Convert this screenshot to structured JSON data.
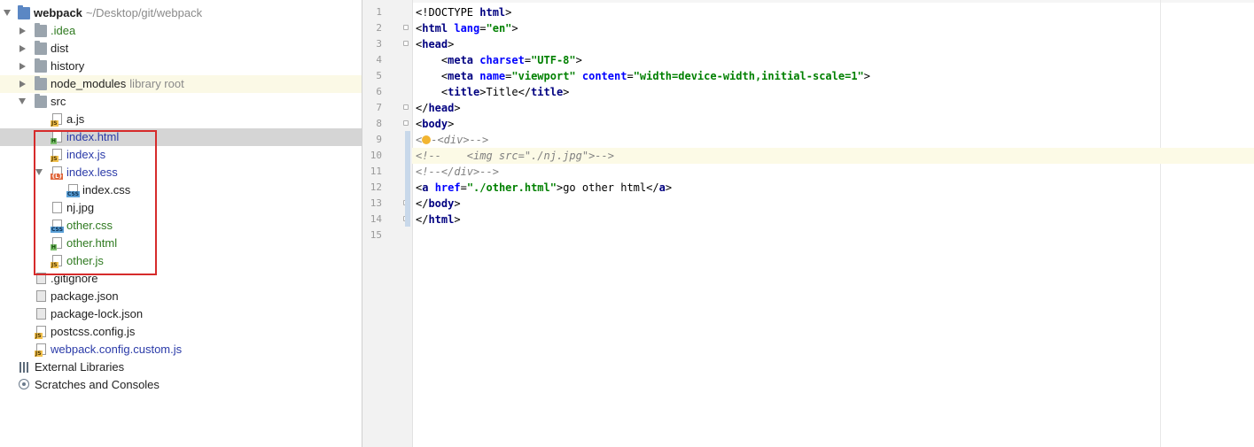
{
  "project_tree": {
    "root": {
      "name": "webpack",
      "path": "~/Desktop/git/webpack"
    },
    "items": [
      {
        "label": ".idea",
        "type": "folder",
        "color": "green"
      },
      {
        "label": "dist",
        "type": "folder"
      },
      {
        "label": "history",
        "type": "folder"
      },
      {
        "label": "node_modules",
        "extra": "library root",
        "type": "folder"
      },
      {
        "label": "src",
        "type": "folder"
      },
      {
        "label": "a.js",
        "badge": "JS"
      },
      {
        "label": "index.html",
        "badge": "H"
      },
      {
        "label": "index.js",
        "badge": "JS"
      },
      {
        "label": "index.less",
        "badge": "{L}"
      },
      {
        "label": "index.css",
        "badge": "CSS"
      },
      {
        "label": "nj.jpg"
      },
      {
        "label": "other.css",
        "badge": "CSS"
      },
      {
        "label": "other.html",
        "badge": "H"
      },
      {
        "label": "other.js",
        "badge": "JS"
      },
      {
        "label": ".gitignore"
      },
      {
        "label": "package.json"
      },
      {
        "label": "package-lock.json"
      },
      {
        "label": "postcss.config.js",
        "badge": "JS"
      },
      {
        "label": "webpack.config.custom.js",
        "badge": "JS"
      },
      {
        "label": "External Libraries"
      },
      {
        "label": "Scratches and Consoles"
      }
    ]
  },
  "editor": {
    "line_numbers": [
      "1",
      "2",
      "3",
      "4",
      "5",
      "6",
      "7",
      "8",
      "9",
      "10",
      "11",
      "12",
      "13",
      "14",
      "15"
    ],
    "lines": [
      [
        {
          "t": "<!DOCTYPE ",
          "c": "txt"
        },
        {
          "t": "html",
          "c": "tag"
        },
        {
          "t": ">",
          "c": "txt"
        }
      ],
      [
        {
          "t": "<",
          "c": "txt"
        },
        {
          "t": "html ",
          "c": "tag"
        },
        {
          "t": "lang",
          "c": "attr"
        },
        {
          "t": "=",
          "c": "txt"
        },
        {
          "t": "\"en\"",
          "c": "str"
        },
        {
          "t": ">",
          "c": "txt"
        }
      ],
      [
        {
          "t": "<",
          "c": "txt"
        },
        {
          "t": "head",
          "c": "tag"
        },
        {
          "t": ">",
          "c": "txt"
        }
      ],
      [
        {
          "t": "    <",
          "c": "txt"
        },
        {
          "t": "meta ",
          "c": "tag"
        },
        {
          "t": "charset",
          "c": "attr"
        },
        {
          "t": "=",
          "c": "txt"
        },
        {
          "t": "\"UTF-8\"",
          "c": "str"
        },
        {
          "t": ">",
          "c": "txt"
        }
      ],
      [
        {
          "t": "    <",
          "c": "txt"
        },
        {
          "t": "meta ",
          "c": "tag"
        },
        {
          "t": "name",
          "c": "attr"
        },
        {
          "t": "=",
          "c": "txt"
        },
        {
          "t": "\"viewport\" ",
          "c": "str"
        },
        {
          "t": "content",
          "c": "attr"
        },
        {
          "t": "=",
          "c": "txt"
        },
        {
          "t": "\"width=device-width,initial-scale=1\"",
          "c": "str"
        },
        {
          "t": ">",
          "c": "txt"
        }
      ],
      [
        {
          "t": "    <",
          "c": "txt"
        },
        {
          "t": "title",
          "c": "tag"
        },
        {
          "t": ">Title</",
          "c": "txt"
        },
        {
          "t": "title",
          "c": "tag"
        },
        {
          "t": ">",
          "c": "txt"
        }
      ],
      [
        {
          "t": "</",
          "c": "txt"
        },
        {
          "t": "head",
          "c": "tag"
        },
        {
          "t": ">",
          "c": "txt"
        }
      ],
      [
        {
          "t": "<",
          "c": "txt"
        },
        {
          "t": "body",
          "c": "tag"
        },
        {
          "t": ">",
          "c": "txt"
        }
      ],
      [
        {
          "t": "<",
          "c": "cmt"
        },
        {
          "t": "BULB",
          "c": "bulb"
        },
        {
          "t": "-<div>-->",
          "c": "cmt"
        }
      ],
      [
        {
          "t": "<!--    <img src=\"./nj.jpg\">-->",
          "c": "cmt"
        }
      ],
      [
        {
          "t": "<!--</div>-->",
          "c": "cmt"
        }
      ],
      [
        {
          "t": "<",
          "c": "txt"
        },
        {
          "t": "a ",
          "c": "tag"
        },
        {
          "t": "href",
          "c": "attr"
        },
        {
          "t": "=",
          "c": "txt"
        },
        {
          "t": "\"./other.html\"",
          "c": "str"
        },
        {
          "t": ">go other html</",
          "c": "txt"
        },
        {
          "t": "a",
          "c": "tag"
        },
        {
          "t": ">",
          "c": "txt"
        }
      ],
      [
        {
          "t": "</",
          "c": "txt"
        },
        {
          "t": "body",
          "c": "tag"
        },
        {
          "t": ">",
          "c": "txt"
        }
      ],
      [
        {
          "t": "</",
          "c": "txt"
        },
        {
          "t": "html",
          "c": "tag"
        },
        {
          "t": ">",
          "c": "txt"
        }
      ],
      []
    ],
    "current_line": 10
  },
  "colors": {
    "selection": "#d5d5d5",
    "highlight_box": "#d62b2b",
    "current_line": "#fcfae6",
    "tag": "#000080",
    "attr": "#0000ff",
    "string": "#008000"
  }
}
